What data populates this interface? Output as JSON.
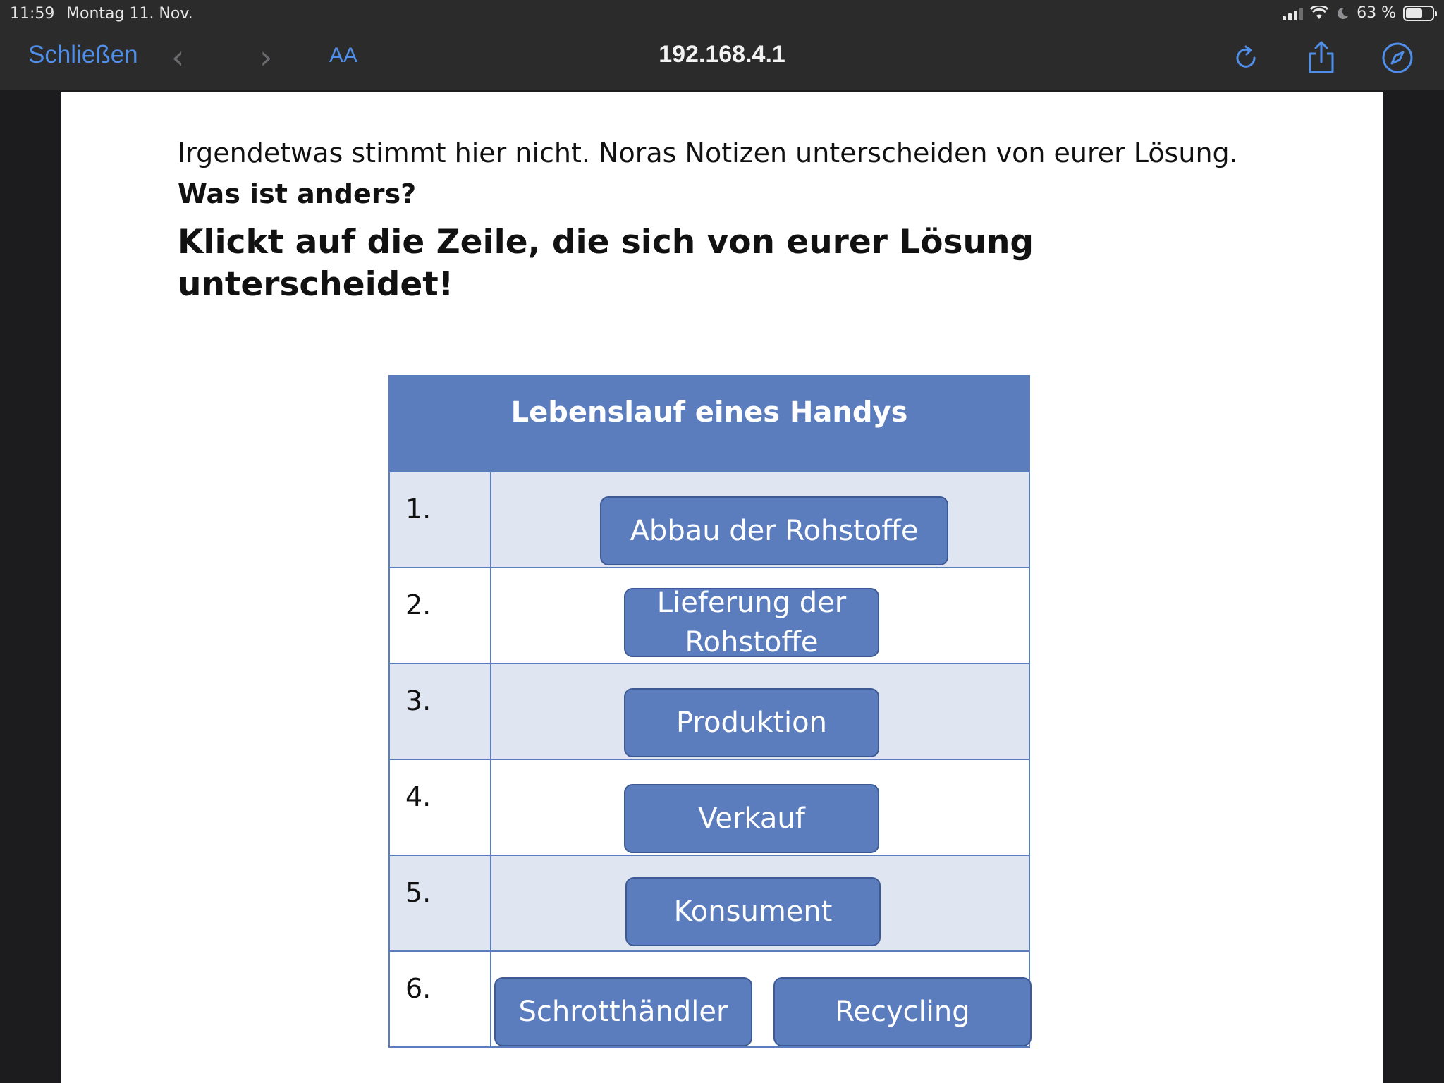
{
  "status": {
    "time": "11:59",
    "date": "Montag 11. Nov.",
    "battery": "63 %"
  },
  "browser": {
    "close_label": "Schließen",
    "back_glyph": "‹",
    "forward_glyph": "›",
    "text_size_label": "AA",
    "url": "192.168.4.1",
    "icons": [
      "reload-icon",
      "share-icon",
      "compass-icon"
    ],
    "accent": "#4f8fea"
  },
  "content": {
    "intro_text": "Irgendetwas stimmt hier nicht. Noras Notizen unterscheiden von eurer Lösung.",
    "intro_bold": "Was ist anders?",
    "instruction": "Klickt auf die Zeile, die sich von eurer Lösung unterscheidet!"
  },
  "table": {
    "title": "Lebenslauf eines Handys",
    "header_color": "#5b7dbd",
    "rows": [
      {
        "num": "1.",
        "items": [
          "Abbau der Rohstoffe"
        ]
      },
      {
        "num": "2.",
        "items": [
          "Lieferung der Rohstoffe"
        ]
      },
      {
        "num": "3.",
        "items": [
          "Produktion"
        ]
      },
      {
        "num": "4.",
        "items": [
          "Verkauf"
        ]
      },
      {
        "num": "5.",
        "items": [
          "Konsument"
        ]
      },
      {
        "num": "6.",
        "items": [
          "Schrotthändler",
          "Recycling"
        ]
      }
    ]
  }
}
